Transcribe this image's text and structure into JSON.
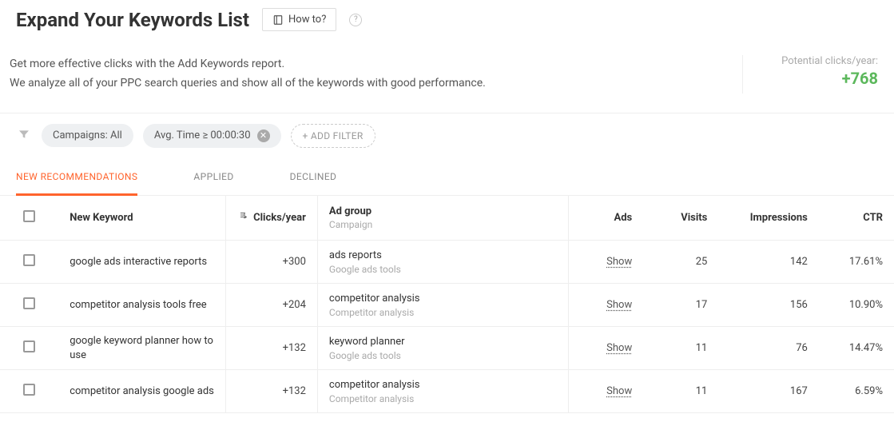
{
  "header": {
    "title": "Expand Your Keywords List",
    "howto_label": "How to?",
    "help_glyph": "?"
  },
  "description": {
    "line1": "Get more effective clicks with the Add Keywords report.",
    "line2": "We analyze all of your PPC search queries and show all of the keywords with good performance."
  },
  "stats": {
    "label": "Potential clicks/year:",
    "value": "+768"
  },
  "toolbar": {
    "filter_icon": "▾",
    "chip_campaigns": "Campaigns: All",
    "chip_avgtime": "Avg. Time ≥ 00:00:30",
    "chip_close": "✕",
    "add_filter": "+ ADD FILTER"
  },
  "tabs": {
    "new": "NEW RECOMMENDATIONS",
    "applied": "APPLIED",
    "declined": "DECLINED"
  },
  "columns": {
    "keyword": "New Keyword",
    "clicks": "Clicks/year",
    "adgroup": "Ad group",
    "adgroup_sub": "Campaign",
    "ads": "Ads",
    "visits": "Visits",
    "impressions": "Impressions",
    "ctr": "CTR",
    "show_label": "Show"
  },
  "rows": [
    {
      "keyword": "google ads interactive reports",
      "clicks": "+300",
      "adgroup": "ads reports",
      "campaign": "Google ads tools",
      "visits": "25",
      "impressions": "142",
      "ctr": "17.61%"
    },
    {
      "keyword": "competitor analysis tools free",
      "clicks": "+204",
      "adgroup": "competitor analysis",
      "campaign": "Competitor analysis",
      "visits": "17",
      "impressions": "156",
      "ctr": "10.90%"
    },
    {
      "keyword": "google keyword planner how to use",
      "clicks": "+132",
      "adgroup": "keyword planner",
      "campaign": "Google ads tools",
      "visits": "11",
      "impressions": "76",
      "ctr": "14.47%"
    },
    {
      "keyword": "competitor analysis google ads",
      "clicks": "+132",
      "adgroup": "competitor analysis",
      "campaign": "Competitor analysis",
      "visits": "11",
      "impressions": "167",
      "ctr": "6.59%"
    }
  ]
}
